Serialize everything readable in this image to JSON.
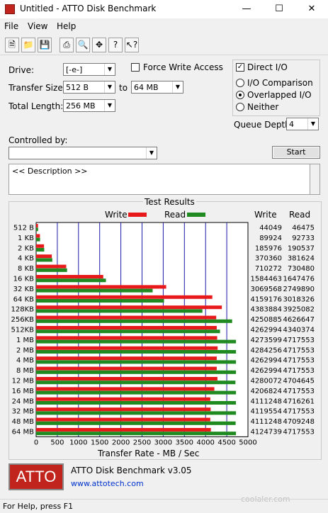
{
  "window": {
    "title": "Untitled - ATTO Disk Benchmark",
    "minimize": "—",
    "maximize": "☐",
    "close": "✕"
  },
  "menu": [
    "File",
    "View",
    "Help"
  ],
  "toolbar": [
    "new-doc-icon",
    "open-folder-icon",
    "save-icon",
    "print-icon",
    "print-preview-icon",
    "move-icon",
    "help-icon",
    "context-help-icon"
  ],
  "settings": {
    "drive_label": "Drive:",
    "drive_value": "[-e-]",
    "transfer_size_label": "Transfer Size:",
    "transfer_from": "512 B",
    "to_label": "to",
    "transfer_to": "64 MB",
    "total_length_label": "Total Length:",
    "total_length": "256 MB",
    "force_write_label": "Force Write Access",
    "force_write_checked": false,
    "direct_io_label": "Direct I/O",
    "direct_io_checked": true,
    "io_comparison_label": "I/O Comparison",
    "overlapped_io_label": "Overlapped I/O",
    "neither_label": "Neither",
    "selected_io_mode": "Overlapped I/O",
    "queue_depth_label": "Queue Depth:",
    "queue_depth": "4",
    "controlled_by_label": "Controlled by:",
    "controlled_by": "",
    "start_label": "Start",
    "description": "<< Description >>"
  },
  "results": {
    "title": "Test Results",
    "write_legend": "Write",
    "read_legend": "Read",
    "write_col": "Write",
    "read_col": "Read",
    "xlabel": "Transfer Rate - MB / Sec",
    "write_color": "#e8191b",
    "read_color": "#1f8a1f"
  },
  "chart_data": {
    "type": "bar",
    "orientation": "horizontal",
    "categories": [
      "512 B",
      "1 KB",
      "2 KB",
      "4 KB",
      "8 KB",
      "16 KB",
      "32 KB",
      "64 KB",
      "128KB",
      "256KB",
      "512KB",
      "1 MB",
      "2 MB",
      "4 MB",
      "8 MB",
      "12 MB",
      "16 MB",
      "24 MB",
      "32 MB",
      "48 MB",
      "64 MB"
    ],
    "series": [
      {
        "name": "Write",
        "values": [
          44049,
          89924,
          185976,
          370360,
          710272,
          1584463,
          3069568,
          4159176,
          4383884,
          4250885,
          4262994,
          4273599,
          4284256,
          4262994,
          4262994,
          4280072,
          4206824,
          4111248,
          4119554,
          4111248,
          4124739
        ]
      },
      {
        "name": "Read",
        "values": [
          46475,
          92733,
          190537,
          381624,
          730480,
          1647476,
          2749890,
          3018326,
          3925082,
          4626647,
          4340374,
          4717553,
          4717553,
          4717553,
          4717553,
          4704645,
          4717553,
          4716261,
          4717553,
          4709248,
          4717553
        ]
      }
    ],
    "xlim": [
      0,
      5000
    ],
    "xticks": [
      0,
      500,
      1000,
      1500,
      2000,
      2500,
      3000,
      3500,
      4000,
      4500,
      5000
    ],
    "xlabel": "Transfer Rate - MB / Sec",
    "grid": true,
    "legend": "top"
  },
  "footer": {
    "logo_text": "ATTO",
    "version": "ATTO Disk Benchmark v3.05",
    "url": "www.attotech.com",
    "status": "For Help, press F1",
    "watermark": "coolaler.com"
  }
}
